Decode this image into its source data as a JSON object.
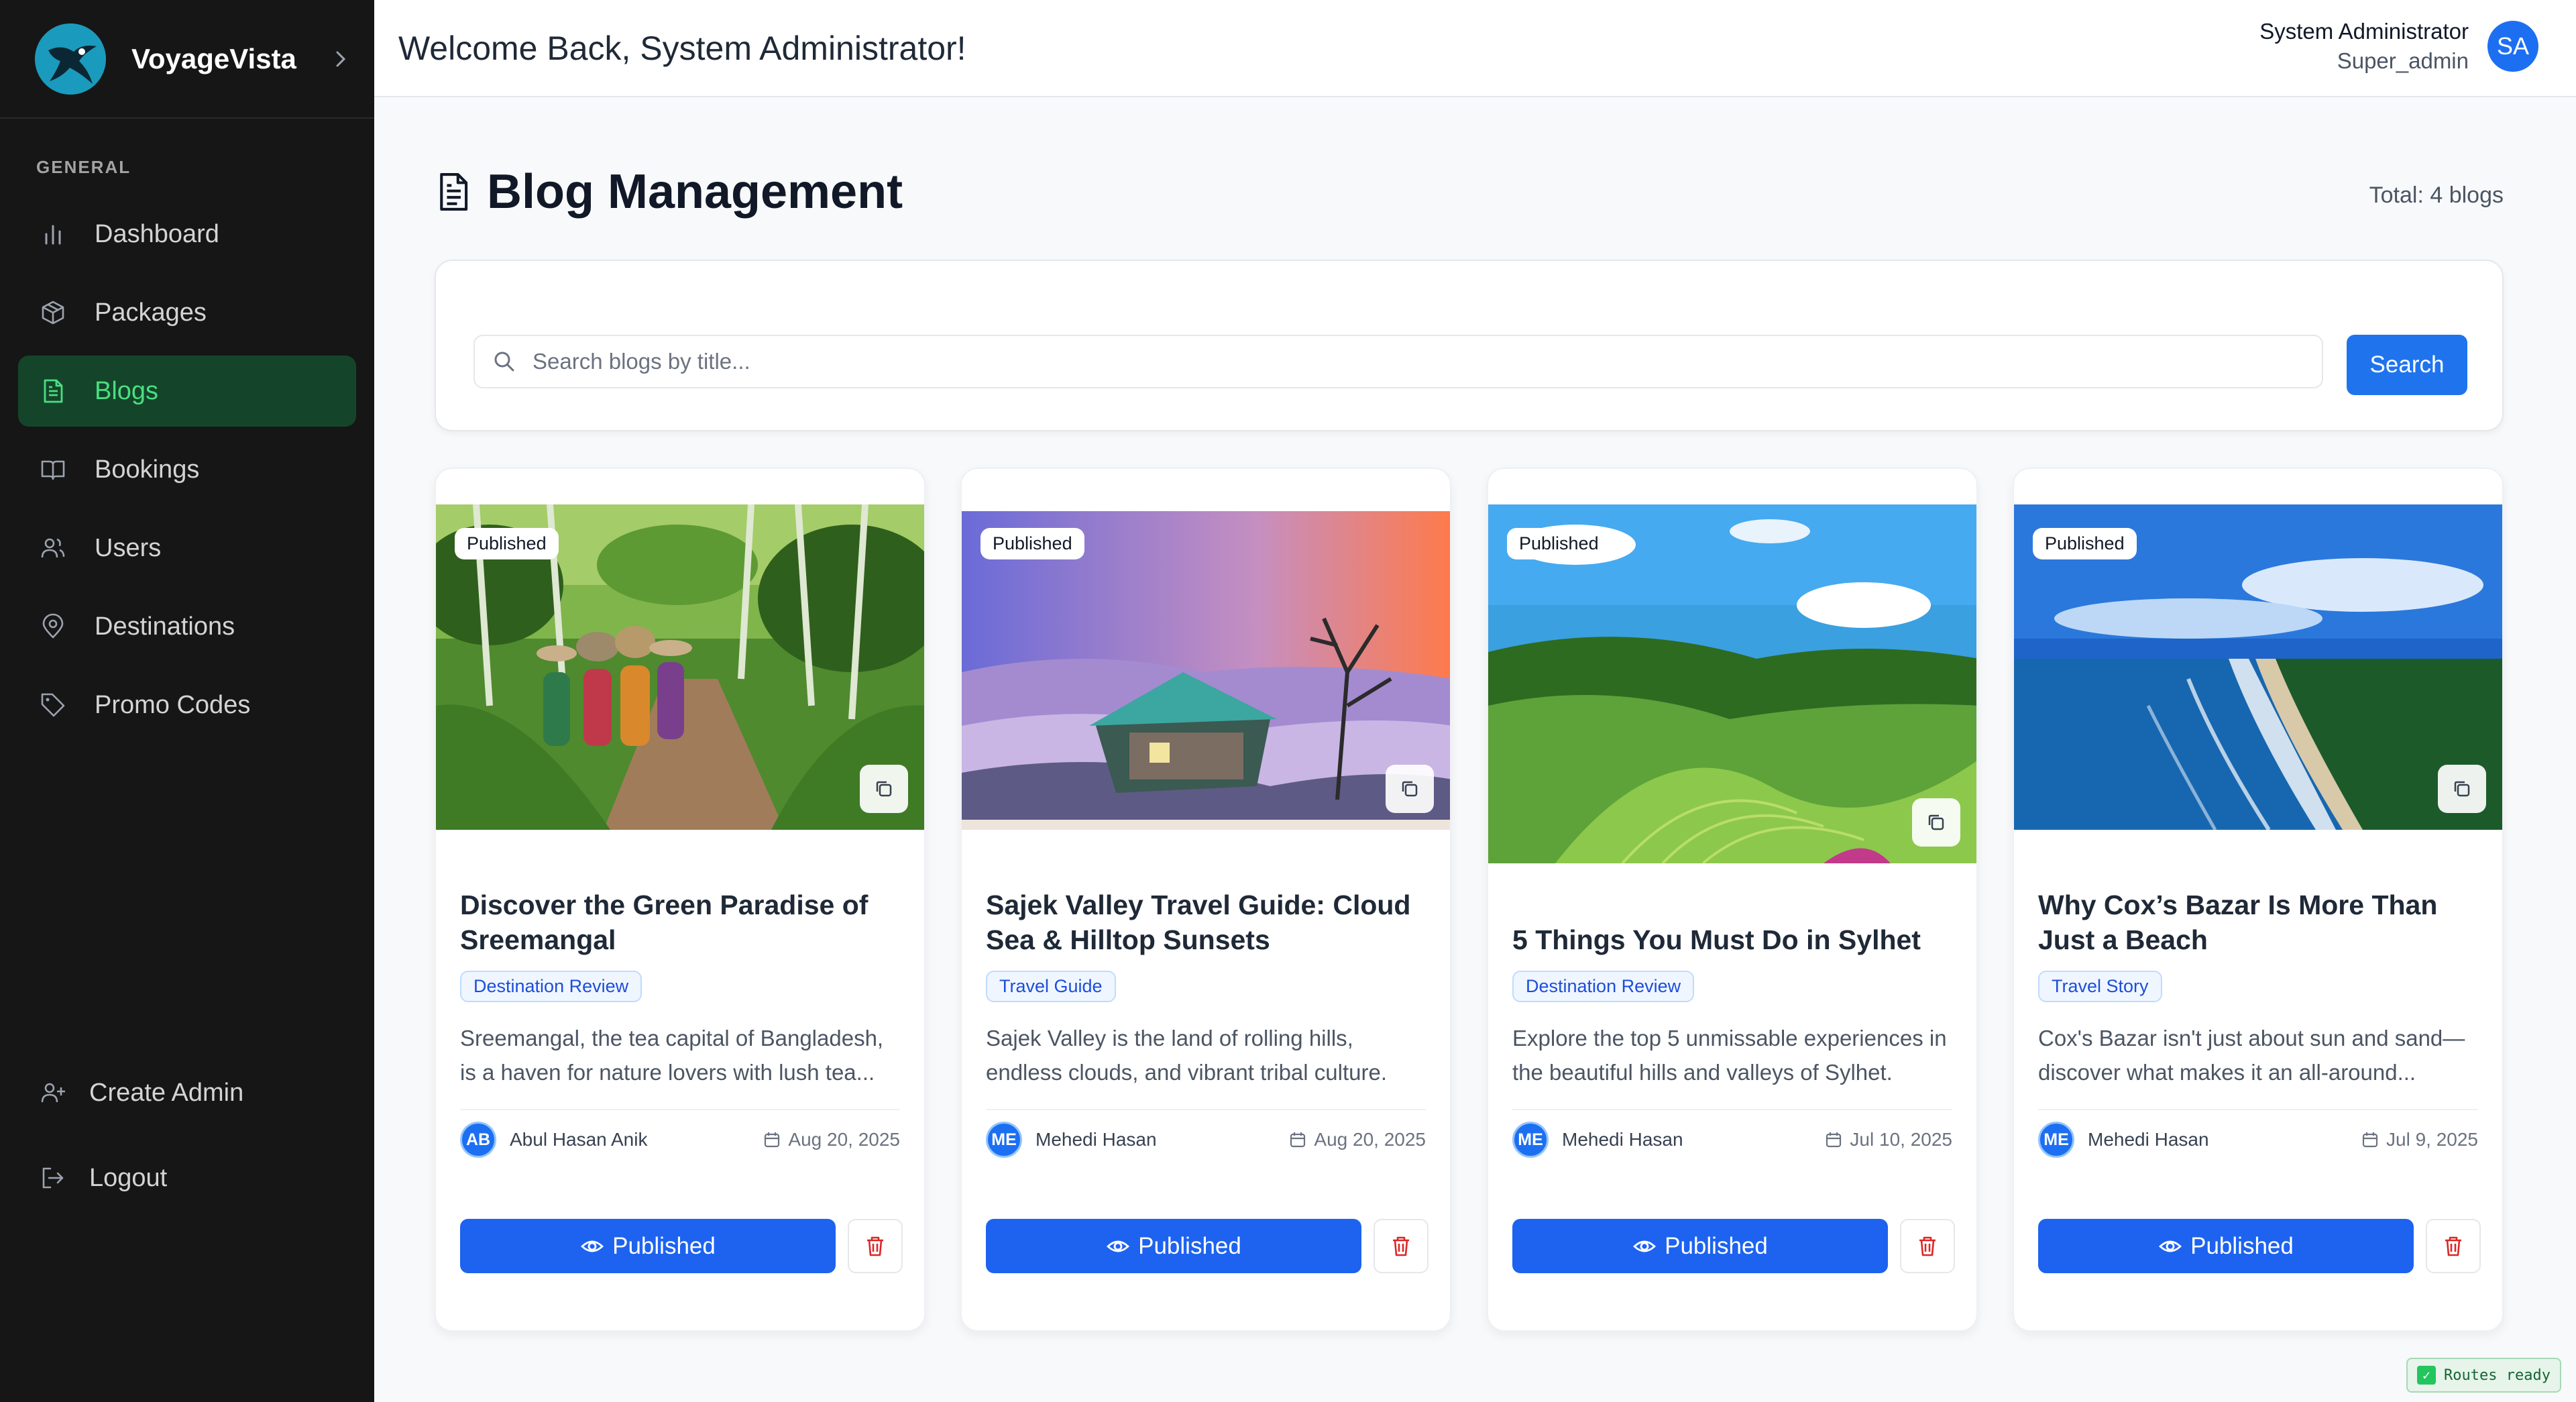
{
  "brand": {
    "name": "VoyageVista"
  },
  "sidebar": {
    "section_label": "GENERAL",
    "items": [
      {
        "label": "Dashboard",
        "icon": "bar-chart-icon",
        "active": false
      },
      {
        "label": "Packages",
        "icon": "package-icon",
        "active": false
      },
      {
        "label": "Blogs",
        "icon": "document-icon",
        "active": true
      },
      {
        "label": "Bookings",
        "icon": "book-icon",
        "active": false
      },
      {
        "label": "Users",
        "icon": "users-icon",
        "active": false
      },
      {
        "label": "Destinations",
        "icon": "map-pin-icon",
        "active": false
      },
      {
        "label": "Promo Codes",
        "icon": "tag-icon",
        "active": false
      }
    ],
    "bottom": [
      {
        "label": "Create Admin",
        "icon": "user-plus-icon"
      },
      {
        "label": "Logout",
        "icon": "logout-icon"
      }
    ]
  },
  "header": {
    "welcome": "Welcome Back, System Administrator!",
    "user_name": "System Administrator",
    "user_role": "Super_admin",
    "avatar_initials": "SA"
  },
  "page": {
    "title": "Blog Management",
    "total": "Total: 4 blogs",
    "search_placeholder": "Search blogs by title...",
    "search_button": "Search"
  },
  "blogs": [
    {
      "status": "Published",
      "title": "Discover the Green Paradise of Sreemangal",
      "category": "Destination Review",
      "excerpt": "Sreemangal, the tea capital of Bangladesh, is a haven for nature lovers with lush tea...",
      "author_initials": "AB",
      "author": "Abul Hasan Anik",
      "date": "Aug 20, 2025",
      "action": "Published"
    },
    {
      "status": "Published",
      "title": "Sajek Valley Travel Guide: Cloud Sea & Hilltop Sunsets",
      "category": "Travel Guide",
      "excerpt": "Sajek Valley is the land of rolling hills, endless clouds, and vibrant tribal culture.",
      "author_initials": "ME",
      "author": "Mehedi Hasan",
      "date": "Aug 20, 2025",
      "action": "Published"
    },
    {
      "status": "Published",
      "title": "5 Things You Must Do in Sylhet",
      "category": "Destination Review",
      "excerpt": "Explore the top 5 unmissable experiences in the beautiful hills and valleys of Sylhet.",
      "author_initials": "ME",
      "author": "Mehedi Hasan",
      "date": "Jul 10, 2025",
      "action": "Published"
    },
    {
      "status": "Published",
      "title": "Why Cox’s Bazar Is More Than Just a Beach",
      "category": "Travel Story",
      "excerpt": "Cox's Bazar isn't just about sun and sand—discover what makes it an all-around...",
      "author_initials": "ME",
      "author": "Mehedi Hasan",
      "date": "Jul 9, 2025",
      "action": "Published"
    }
  ],
  "status_bar": {
    "routes_ready": "Routes ready"
  },
  "colors": {
    "primary": "#1d63f0",
    "sidebar_bg": "#161616",
    "active_green": "#4ade80",
    "danger": "#dc2626"
  }
}
